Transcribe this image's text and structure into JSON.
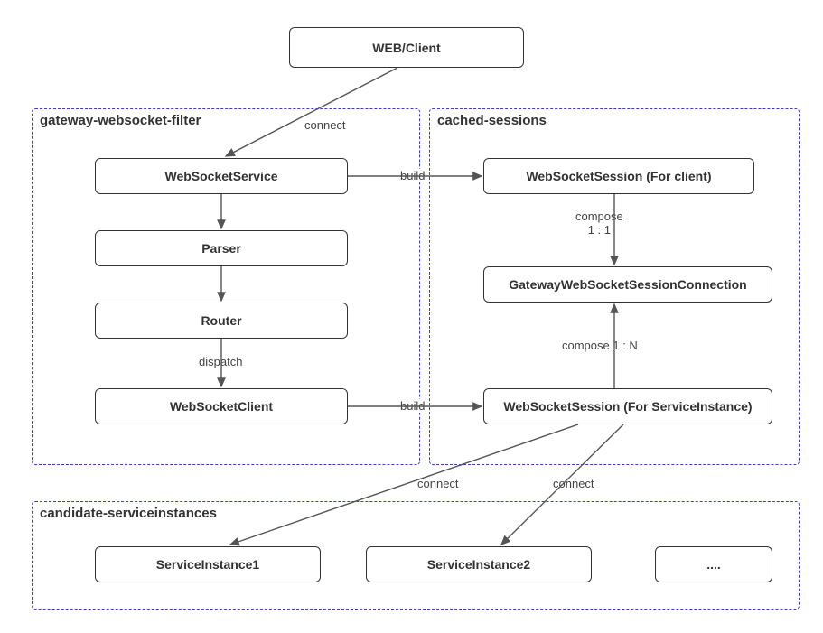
{
  "nodes": {
    "web_client": "WEB/Client",
    "websocket_service": "WebSocketService",
    "parser": "Parser",
    "router": "Router",
    "websocket_client": "WebSocketClient",
    "ws_session_client": "WebSocketSession (For client)",
    "gw_session_conn": "GatewayWebSocketSessionConnection",
    "ws_session_si": "WebSocketSession (For ServiceInstance)",
    "si1": "ServiceInstance1",
    "si2": "ServiceInstance2",
    "si_more": "...."
  },
  "groups": {
    "g1": "gateway-websocket-filter",
    "g2": "cached-sessions",
    "g3": "candidate-serviceinstances"
  },
  "edges": {
    "connect_top": "connect",
    "build1": "build",
    "dispatch": "dispatch",
    "build2": "build",
    "compose_11": "compose\n1 : 1",
    "compose_1n": "compose 1 : N",
    "connect_l": "connect",
    "connect_r": "connect"
  },
  "chart_data": {
    "type": "diagram",
    "title": "WebSocket Gateway Architecture",
    "nodes": [
      {
        "id": "web_client",
        "label": "WEB/Client"
      },
      {
        "id": "websocket_service",
        "label": "WebSocketService",
        "group": "gateway-websocket-filter"
      },
      {
        "id": "parser",
        "label": "Parser",
        "group": "gateway-websocket-filter"
      },
      {
        "id": "router",
        "label": "Router",
        "group": "gateway-websocket-filter"
      },
      {
        "id": "websocket_client",
        "label": "WebSocketClient",
        "group": "gateway-websocket-filter"
      },
      {
        "id": "ws_session_client",
        "label": "WebSocketSession (For client)",
        "group": "cached-sessions"
      },
      {
        "id": "gw_session_conn",
        "label": "GatewayWebSocketSessionConnection",
        "group": "cached-sessions"
      },
      {
        "id": "ws_session_si",
        "label": "WebSocketSession (For ServiceInstance)",
        "group": "cached-sessions"
      },
      {
        "id": "si1",
        "label": "ServiceInstance1",
        "group": "candidate-serviceinstances"
      },
      {
        "id": "si2",
        "label": "ServiceInstance2",
        "group": "candidate-serviceinstances"
      },
      {
        "id": "si_more",
        "label": "....",
        "group": "candidate-serviceinstances"
      }
    ],
    "groups": [
      {
        "id": "gateway-websocket-filter",
        "label": "gateway-websocket-filter"
      },
      {
        "id": "cached-sessions",
        "label": "cached-sessions"
      },
      {
        "id": "candidate-serviceinstances",
        "label": "candidate-serviceinstances"
      }
    ],
    "edges": [
      {
        "from": "web_client",
        "to": "websocket_service",
        "label": "connect"
      },
      {
        "from": "websocket_service",
        "to": "parser"
      },
      {
        "from": "parser",
        "to": "router"
      },
      {
        "from": "router",
        "to": "websocket_client",
        "label": "dispatch"
      },
      {
        "from": "websocket_service",
        "to": "ws_session_client",
        "label": "build"
      },
      {
        "from": "websocket_client",
        "to": "ws_session_si",
        "label": "build"
      },
      {
        "from": "ws_session_client",
        "to": "gw_session_conn",
        "label": "compose 1 : 1"
      },
      {
        "from": "ws_session_si",
        "to": "gw_session_conn",
        "label": "compose 1 : N"
      },
      {
        "from": "ws_session_si",
        "to": "si1",
        "label": "connect"
      },
      {
        "from": "ws_session_si",
        "to": "si2",
        "label": "connect"
      }
    ]
  }
}
